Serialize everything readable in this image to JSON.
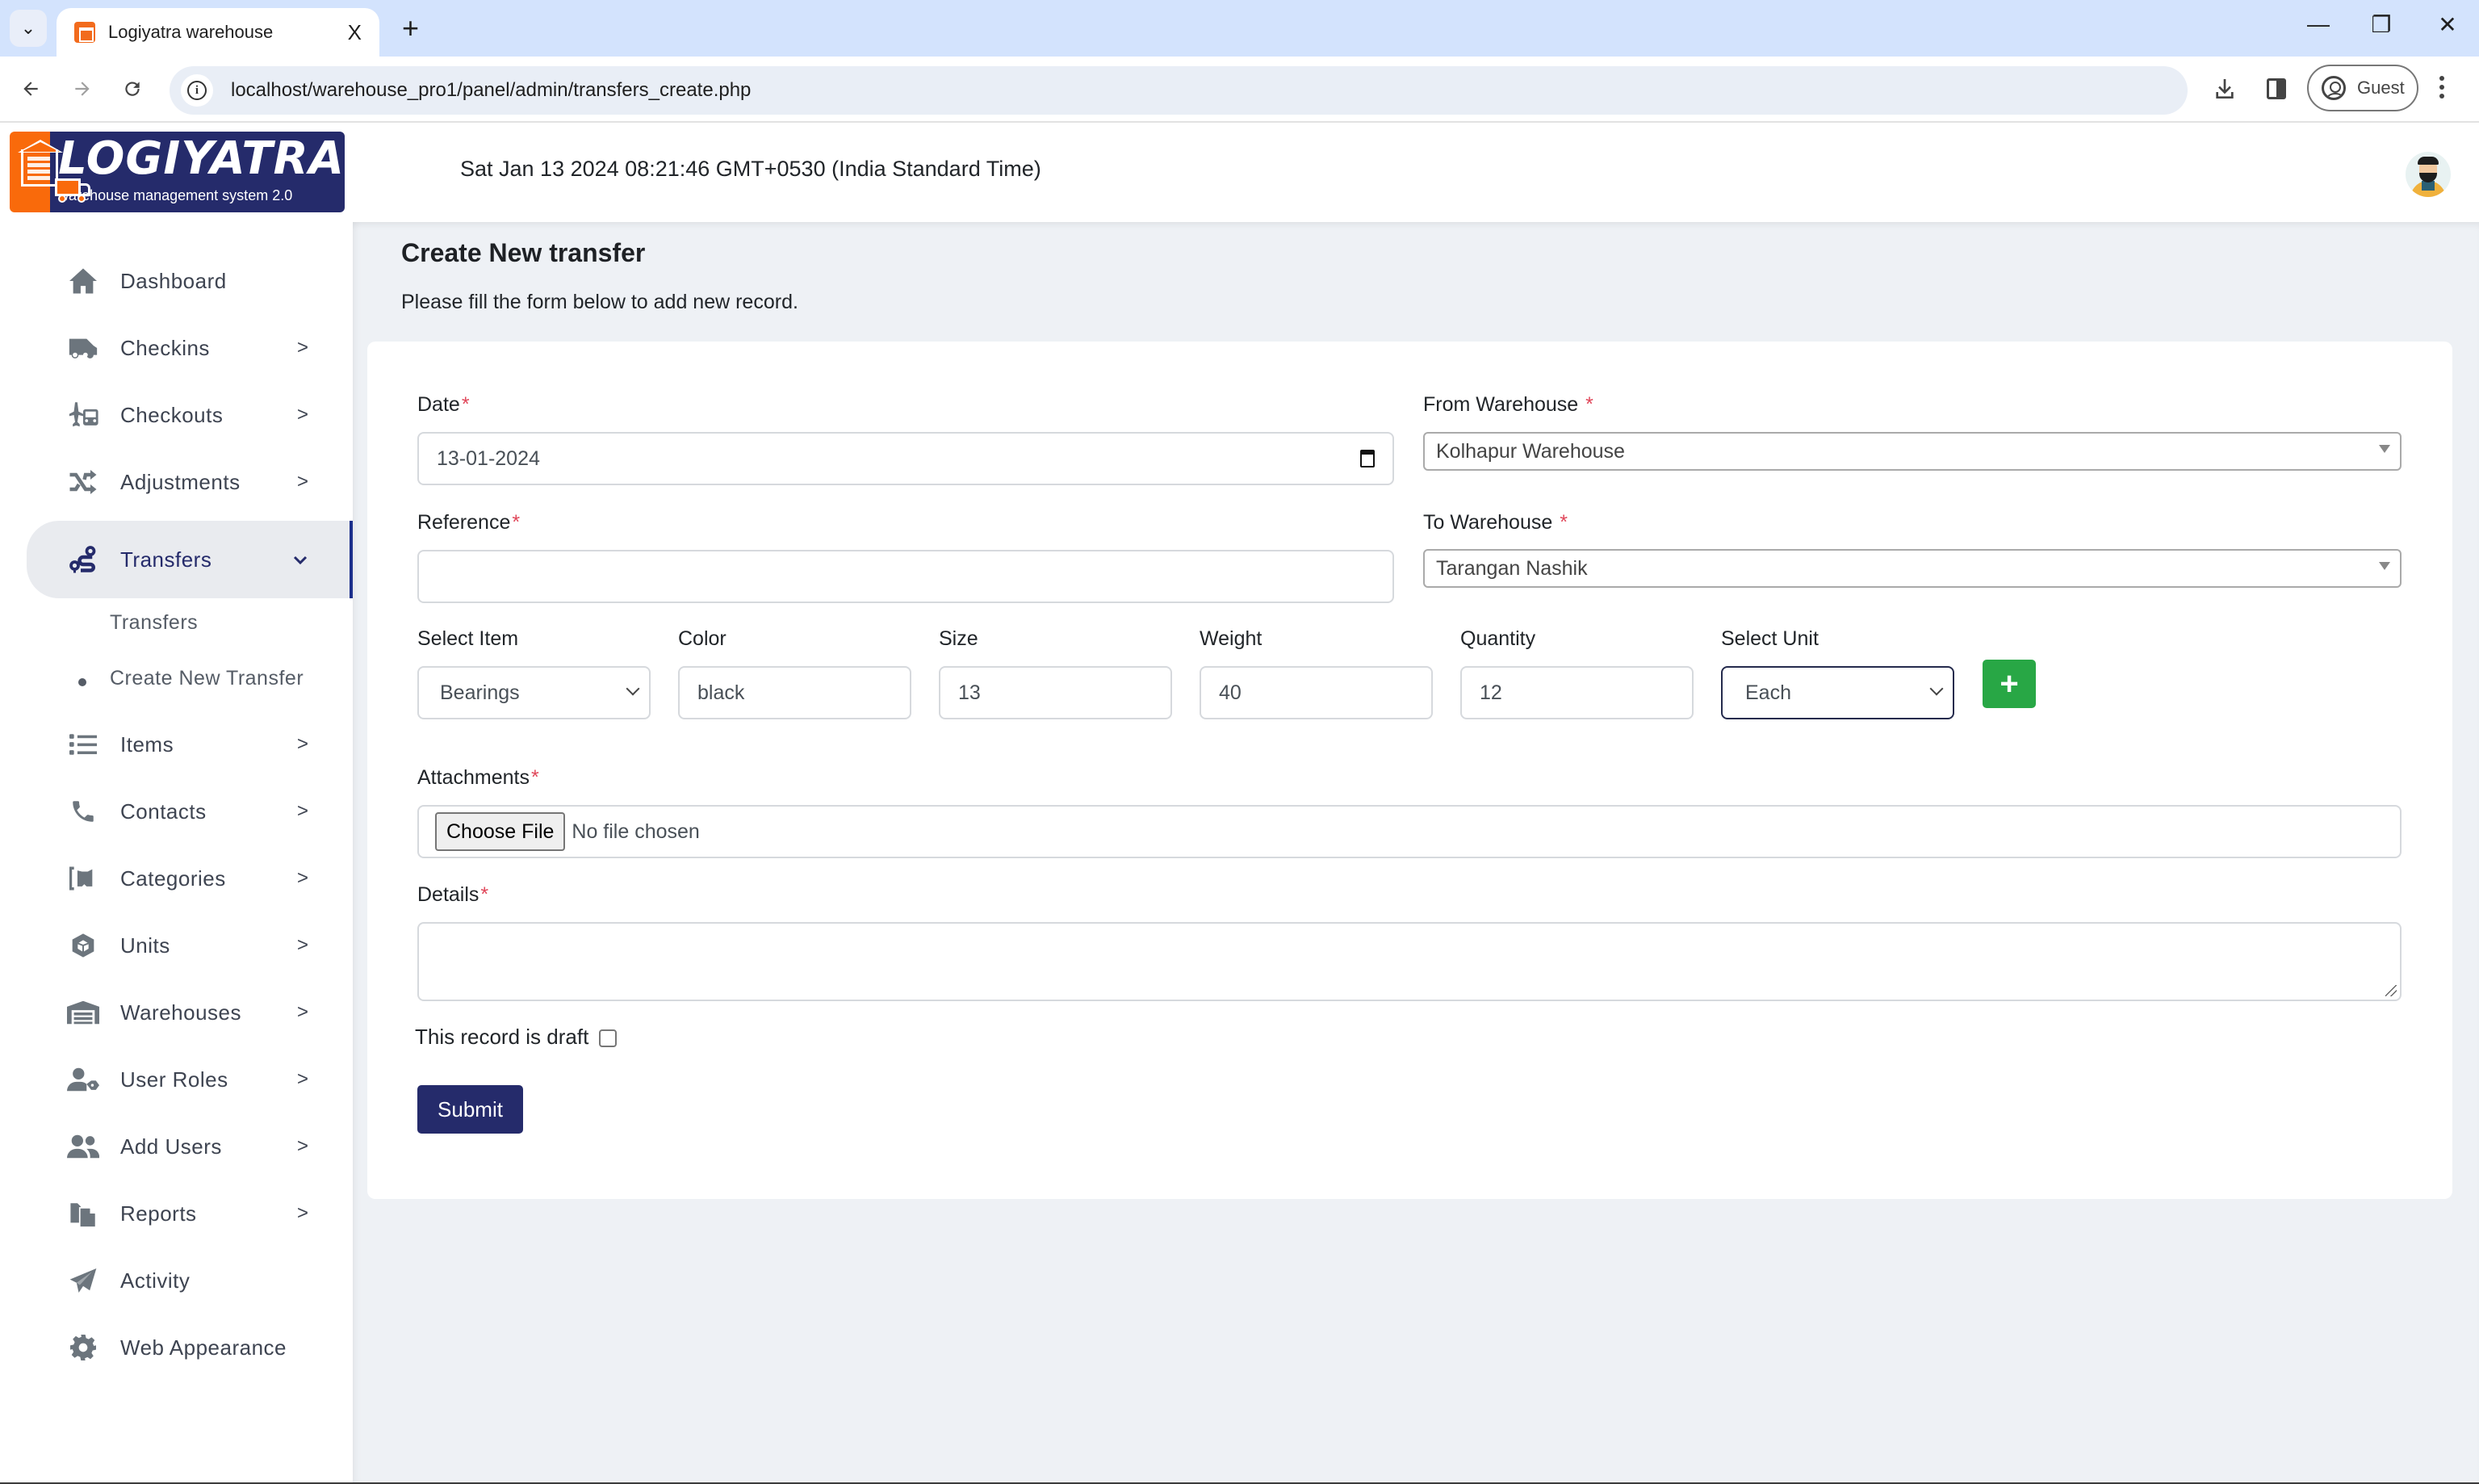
{
  "browser": {
    "tab_title": "Logiyatra warehouse",
    "tab_close": "X",
    "new_tab": "+",
    "url": "localhost/warehouse_pro1/panel/admin/transfers_create.php",
    "profile_label": "Guest",
    "window_controls": {
      "minimize": "—",
      "maximize": "❐",
      "close": "✕"
    },
    "icons": {
      "back": "arrow-left-icon",
      "forward": "arrow-right-icon",
      "reload": "reload-icon",
      "info": "info-icon",
      "download": "download-icon",
      "side_panel": "side-panel-icon",
      "menu": "kebab-menu-icon"
    }
  },
  "header": {
    "logo_title": "LOGIYATRA",
    "logo_subtitle": "warehouse management system 2.0",
    "datetime": "Sat Jan 13 2024 08:21:46 GMT+0530 (India Standard Time)"
  },
  "sidebar": {
    "items": [
      {
        "label": "Dashboard",
        "icon": "home-icon",
        "has_children": false
      },
      {
        "label": "Checkins",
        "icon": "truck-icon",
        "has_children": true
      },
      {
        "label": "Checkouts",
        "icon": "plane-truck-icon",
        "has_children": true
      },
      {
        "label": "Adjustments",
        "icon": "shuffle-icon",
        "has_children": true
      },
      {
        "label": "Transfers",
        "icon": "route-icon",
        "has_children": true,
        "active": true,
        "expanded": true
      },
      {
        "label": "Items",
        "icon": "list-icon",
        "has_children": true
      },
      {
        "label": "Contacts",
        "icon": "phone-icon",
        "has_children": true
      },
      {
        "label": "Categories",
        "icon": "categories-icon",
        "has_children": true
      },
      {
        "label": "Units",
        "icon": "cube-icon",
        "has_children": true
      },
      {
        "label": "Warehouses",
        "icon": "warehouse-icon",
        "has_children": true
      },
      {
        "label": "User Roles",
        "icon": "user-tag-icon",
        "has_children": true
      },
      {
        "label": "Add Users",
        "icon": "users-icon",
        "has_children": true
      },
      {
        "label": "Reports",
        "icon": "reports-icon",
        "has_children": true
      },
      {
        "label": "Activity",
        "icon": "paper-plane-icon",
        "has_children": false
      },
      {
        "label": "Web Appearance",
        "icon": "gear-icon",
        "has_children": false
      }
    ],
    "transfers_submenu": [
      {
        "label": "Transfers",
        "current": false
      },
      {
        "label": "Create New Transfer",
        "current": true
      }
    ],
    "chevron_right": ">",
    "chevron_down": "⌄"
  },
  "page": {
    "title": "Create New transfer",
    "subtitle": "Please fill the form below to add new record."
  },
  "form": {
    "required_mark": "*",
    "date": {
      "label": "Date",
      "value": "13-01-2024"
    },
    "from_warehouse": {
      "label": "From Warehouse",
      "value": "Kolhapur Warehouse"
    },
    "reference": {
      "label": "Reference",
      "value": ""
    },
    "to_warehouse": {
      "label": "To Warehouse",
      "value": "Tarangan Nashik"
    },
    "item_row": {
      "select_item": {
        "label": "Select Item",
        "value": "Bearings"
      },
      "color": {
        "label": "Color",
        "value": "black"
      },
      "size": {
        "label": "Size",
        "value": "13"
      },
      "weight": {
        "label": "Weight",
        "value": "40"
      },
      "quantity": {
        "label": "Quantity",
        "value": "12"
      },
      "select_unit": {
        "label": "Select Unit",
        "value": "Each"
      },
      "add_button": "+"
    },
    "attachments": {
      "label": "Attachments",
      "button": "Choose File",
      "status": "No file chosen"
    },
    "details": {
      "label": "Details",
      "value": ""
    },
    "draft": {
      "label": "This record is draft",
      "checked": false
    },
    "submit_label": "Submit"
  },
  "colors": {
    "brand_navy": "#252b6b",
    "brand_orange": "#f96a0b",
    "add_green": "#28a745",
    "required_red": "#e0475a",
    "active_indicator": "#1b2f8c",
    "main_bg": "#eef1f5"
  }
}
